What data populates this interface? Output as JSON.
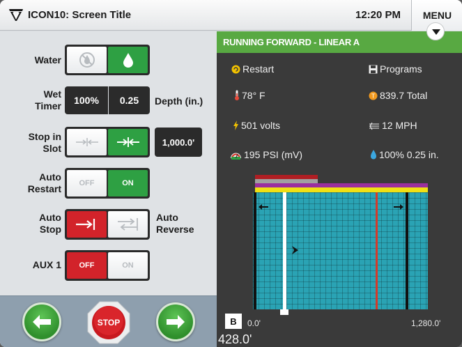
{
  "header": {
    "title": "ICON10: Screen Title",
    "time": "12:20 PM",
    "menu_label": "MENU"
  },
  "controls": {
    "water": {
      "label": "Water",
      "state": "on"
    },
    "wet_timer": {
      "label": "Wet Timer",
      "percent": "100%",
      "depth": "0.25",
      "depth_label": "Depth (in.)"
    },
    "stop_in_slot": {
      "label": "Stop in Slot",
      "value": "1,000.0'"
    },
    "auto_restart": {
      "label": "Auto Restart",
      "off_label": "OFF",
      "on_label": "ON",
      "state": "on"
    },
    "auto_stop": {
      "label": "Auto Stop",
      "reverse_label": "Auto Reverse",
      "state": "stop"
    },
    "aux1": {
      "label": "AUX 1",
      "off_label": "OFF",
      "on_label": "ON",
      "state": "off"
    }
  },
  "bottom_buttons": {
    "stop_label": "STOP"
  },
  "status": {
    "banner": "RUNNING FORWARD - LINEAR A",
    "banner_color": "#58a942",
    "restart": "Restart",
    "programs": "Programs",
    "temperature": "78° F",
    "total": "839.7 Total",
    "volts": "501 volts",
    "speed": "12 MPH",
    "pressure": "195 PSI (mV)",
    "application": "100% 0.25 in."
  },
  "map": {
    "b_label": "B",
    "start_label": "0.0'",
    "end_label": "1,280.0'",
    "position_label": "428.0'",
    "field_color": "#2aa3b4",
    "machine_position_fraction": 0.17,
    "stop_in_slot_fraction": 0.781,
    "direction": "forward"
  }
}
